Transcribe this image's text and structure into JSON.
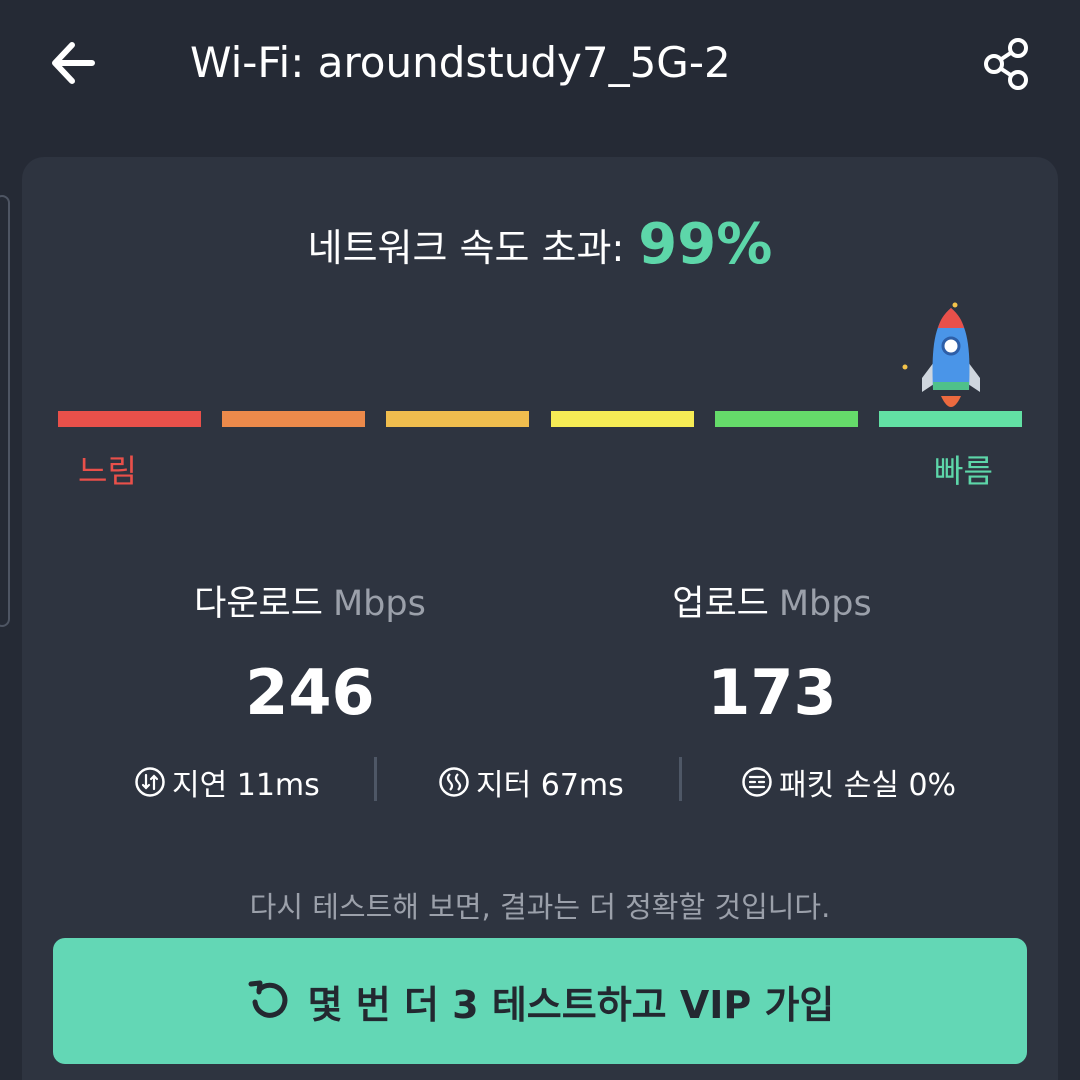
{
  "header": {
    "title": "Wi-Fi: aroundstudy7_5G-2",
    "back_icon": "arrow-left-icon",
    "share_icon": "share-icon"
  },
  "result": {
    "headline_label": "네트워크 속도 초과:",
    "percentile": "99%",
    "speed_scale": {
      "segments": [
        "#e9504a",
        "#ec8a4b",
        "#f0bd4e",
        "#f6ec55",
        "#65db6a",
        "#62e0a4"
      ],
      "active_segment": 6,
      "slow_label": "느림",
      "fast_label": "빠름",
      "indicator_icon": "rocket-icon"
    }
  },
  "download": {
    "label": "다운로드",
    "unit": "Mbps",
    "value": "246"
  },
  "upload": {
    "label": "업로드",
    "unit": "Mbps",
    "value": "173"
  },
  "metrics": {
    "latency": {
      "icon": "latency-icon",
      "text": "지연 11ms"
    },
    "jitter": {
      "icon": "jitter-icon",
      "text": "지터 67ms"
    },
    "packet_loss": {
      "icon": "packet-loss-icon",
      "text": "패킷 손실 0%"
    }
  },
  "retest_note": "다시 테스트해 보면, 결과는 더 정확할 것입니다.",
  "cta": {
    "icon": "retry-icon",
    "label": "몇 번 더 3 테스트하고 VIP 가입"
  },
  "colors": {
    "background": "#252a35",
    "card": "#2e3440",
    "accent": "#5dd6a9",
    "cta": "#63d7b5",
    "slow": "#e9504a"
  }
}
